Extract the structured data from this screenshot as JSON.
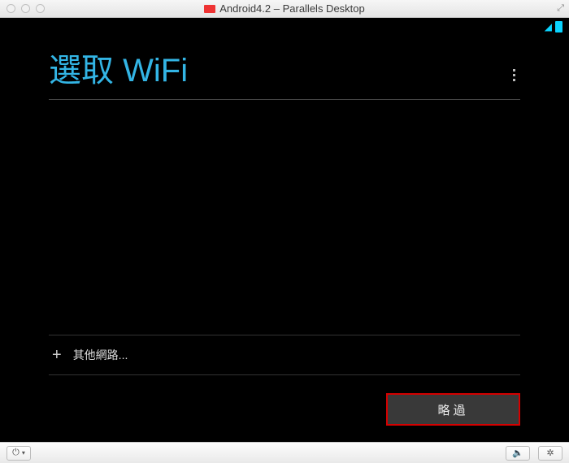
{
  "window": {
    "title": "Android4.2 – Parallels Desktop"
  },
  "android": {
    "title_prefix": "選取",
    "title_rest": " WiFi",
    "other_network_label": "其他網路...",
    "skip_label": "略過"
  },
  "bottombar": {
    "power_glyph": "⏻",
    "speaker_glyph": "🔈",
    "gear_glyph": "✲"
  }
}
